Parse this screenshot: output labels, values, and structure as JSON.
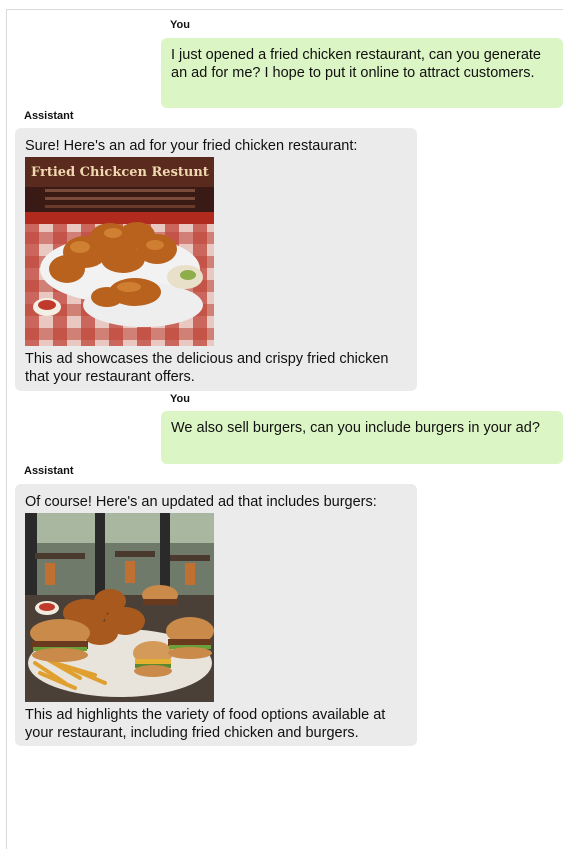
{
  "conversation": {
    "messages": [
      {
        "role": "You",
        "text": "I just opened a fried chicken restaurant, can you generate an ad for me? I hope to put it online to attract customers."
      },
      {
        "role": "Assistant",
        "intro": "Sure! Here's an ad for your fried chicken restaurant:",
        "image_sign_text": "Frtied Chickcen Restunt",
        "image_subject": "fried-chicken-ad-image",
        "outro": "This ad showcases the delicious and crispy fried chicken that your restaurant offers."
      },
      {
        "role": "You",
        "text": "We also sell burgers, can you include burgers in your ad?"
      },
      {
        "role": "Assistant",
        "intro": "Of course! Here's an updated ad that includes burgers:",
        "image_subject": "chicken-and-burgers-ad-image",
        "outro": "This ad highlights the variety of food options available at your restaurant, including fried chicken and burgers."
      }
    ]
  },
  "colors": {
    "user_bubble": "#dcf5c4",
    "assistant_bubble": "#ebebeb"
  }
}
